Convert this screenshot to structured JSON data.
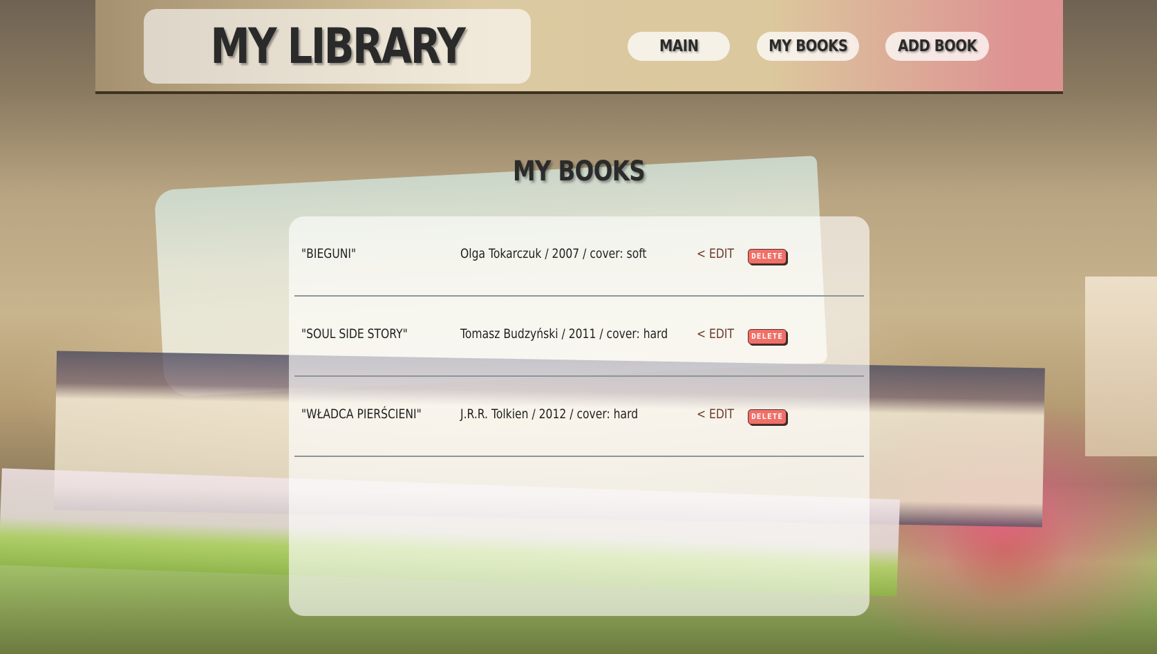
{
  "header": {
    "logo": "MY LIBRARY",
    "nav": [
      {
        "label": "MAIN"
      },
      {
        "label": "MY BOOKS"
      },
      {
        "label": "ADD BOOK"
      }
    ]
  },
  "main": {
    "title": "MY BOOKS",
    "books": [
      {
        "title": "\"BIEGUNI\"",
        "info": "Olga Tokarczuk / 2007 / cover: soft",
        "edit_label": "< EDIT",
        "delete_label": "DELETE"
      },
      {
        "title": "\"SOUL SIDE STORY\"",
        "info": "Tomasz Budzyński / 2011 / cover: hard",
        "edit_label": "< EDIT",
        "delete_label": "DELETE"
      },
      {
        "title": "\"WŁADCA PIERŚCIENI\"",
        "info": "J.R.R. Tolkien / 2012 / cover: hard",
        "edit_label": "< EDIT",
        "delete_label": "DELETE"
      }
    ]
  },
  "colors": {
    "delete_button": "#f07068",
    "edit_link": "#6b3a2a",
    "header_border": "#3e3322"
  }
}
